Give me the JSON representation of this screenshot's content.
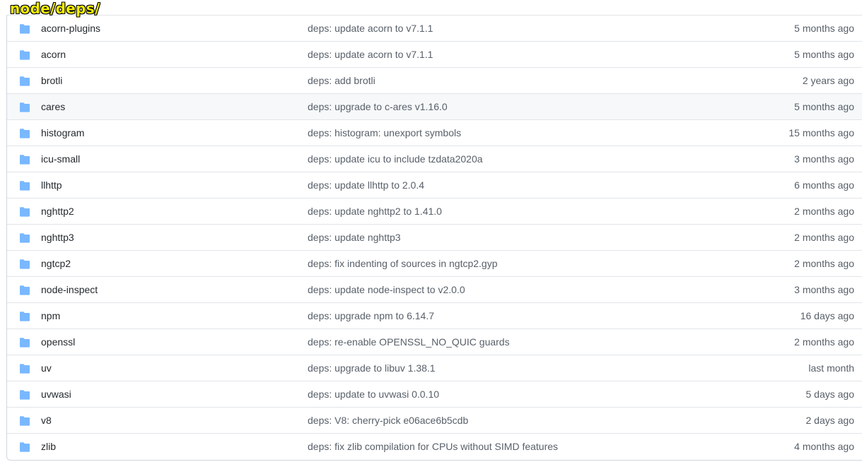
{
  "path_title": "node/deps/",
  "colors": {
    "folder": "#79b8ff",
    "highlight_row": "#f6f8fa",
    "title_fill": "#f6f000"
  },
  "highlighted_row_index": 3,
  "rows": [
    {
      "name": "acorn-plugins",
      "message": "deps: update acorn to v7.1.1",
      "age": "5 months ago",
      "icon": "folder-icon"
    },
    {
      "name": "acorn",
      "message": "deps: update acorn to v7.1.1",
      "age": "5 months ago",
      "icon": "folder-icon"
    },
    {
      "name": "brotli",
      "message": "deps: add brotli",
      "age": "2 years ago",
      "icon": "folder-icon"
    },
    {
      "name": "cares",
      "message": "deps: upgrade to c-ares v1.16.0",
      "age": "5 months ago",
      "icon": "folder-icon"
    },
    {
      "name": "histogram",
      "message": "deps: histogram: unexport symbols",
      "age": "15 months ago",
      "icon": "folder-icon"
    },
    {
      "name": "icu-small",
      "message": "deps: update icu to include tzdata2020a",
      "age": "3 months ago",
      "icon": "folder-icon"
    },
    {
      "name": "llhttp",
      "message": "deps: update llhttp to 2.0.4",
      "age": "6 months ago",
      "icon": "folder-icon"
    },
    {
      "name": "nghttp2",
      "message": "deps: update nghttp2 to 1.41.0",
      "age": "2 months ago",
      "icon": "folder-icon"
    },
    {
      "name": "nghttp3",
      "message": "deps: update nghttp3",
      "age": "2 months ago",
      "icon": "folder-icon"
    },
    {
      "name": "ngtcp2",
      "message": "deps: fix indenting of sources in ngtcp2.gyp",
      "age": "2 months ago",
      "icon": "folder-icon"
    },
    {
      "name": "node-inspect",
      "message": "deps: update node-inspect to v2.0.0",
      "age": "3 months ago",
      "icon": "folder-icon"
    },
    {
      "name": "npm",
      "message": "deps: upgrade npm to 6.14.7",
      "age": "16 days ago",
      "icon": "folder-icon"
    },
    {
      "name": "openssl",
      "message": "deps: re-enable OPENSSL_NO_QUIC guards",
      "age": "2 months ago",
      "icon": "folder-icon"
    },
    {
      "name": "uv",
      "message": "deps: upgrade to libuv 1.38.1",
      "age": "last month",
      "icon": "folder-icon"
    },
    {
      "name": "uvwasi",
      "message": "deps: update to uvwasi 0.0.10",
      "age": "5 days ago",
      "icon": "folder-icon"
    },
    {
      "name": "v8",
      "message": "deps: V8: cherry-pick e06ace6b5cdb",
      "age": "2 days ago",
      "icon": "folder-icon"
    },
    {
      "name": "zlib",
      "message": "deps: fix zlib compilation for CPUs without SIMD features",
      "age": "4 months ago",
      "icon": "folder-icon"
    }
  ]
}
